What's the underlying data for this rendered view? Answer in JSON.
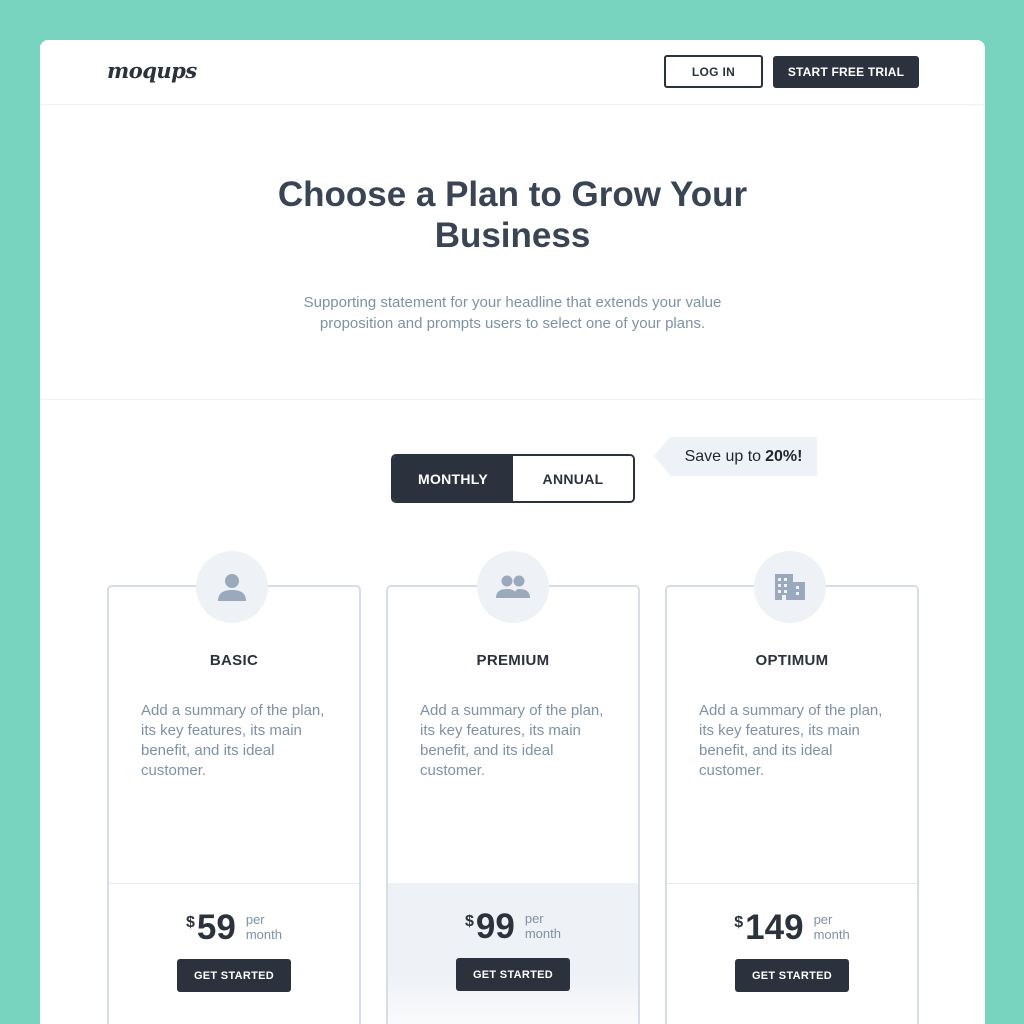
{
  "header": {
    "logo": "moqups",
    "login_label": "LOG IN",
    "trial_label": "START FREE TRIAL"
  },
  "hero": {
    "headline_line1": "Choose a Plan to Grow Your",
    "headline_line2": "Business",
    "subline_line1": "Supporting statement for your headline that extends your value",
    "subline_line2": "proposition and prompts users to select one of your plans."
  },
  "billing_toggle": {
    "monthly_label": "MONTHLY",
    "annual_label": "ANNUAL",
    "selected": "MONTHLY"
  },
  "save_badge": {
    "prefix": "Save up to",
    "highlight": "20%!"
  },
  "plans": [
    {
      "icon": "person-icon",
      "name": "BASIC",
      "description": "Add a summary of the plan, its key features, its main benefit, and its ideal customer.",
      "currency": "$",
      "price": "59",
      "per_line1": "per",
      "per_line2": "month",
      "cta": "GET STARTED"
    },
    {
      "icon": "people-icon",
      "name": "PREMIUM",
      "description": "Add a summary of the plan, its key features, its main benefit, and its ideal customer.",
      "currency": "$",
      "price": "99",
      "per_line1": "per",
      "per_line2": "month",
      "cta": "GET STARTED"
    },
    {
      "icon": "building-icon",
      "name": "OPTIMUM",
      "description": "Add a summary of the plan, its key features, its main benefit, and its ideal customer.",
      "currency": "$",
      "price": "149",
      "per_line1": "per",
      "per_line2": "month",
      "cta": "GET STARTED"
    }
  ],
  "colors": {
    "background": "#78d3bf",
    "dark": "#2b323d",
    "muted_text": "#7f91a7",
    "icon": "#9aaabc",
    "panel": "#eef1f5"
  }
}
